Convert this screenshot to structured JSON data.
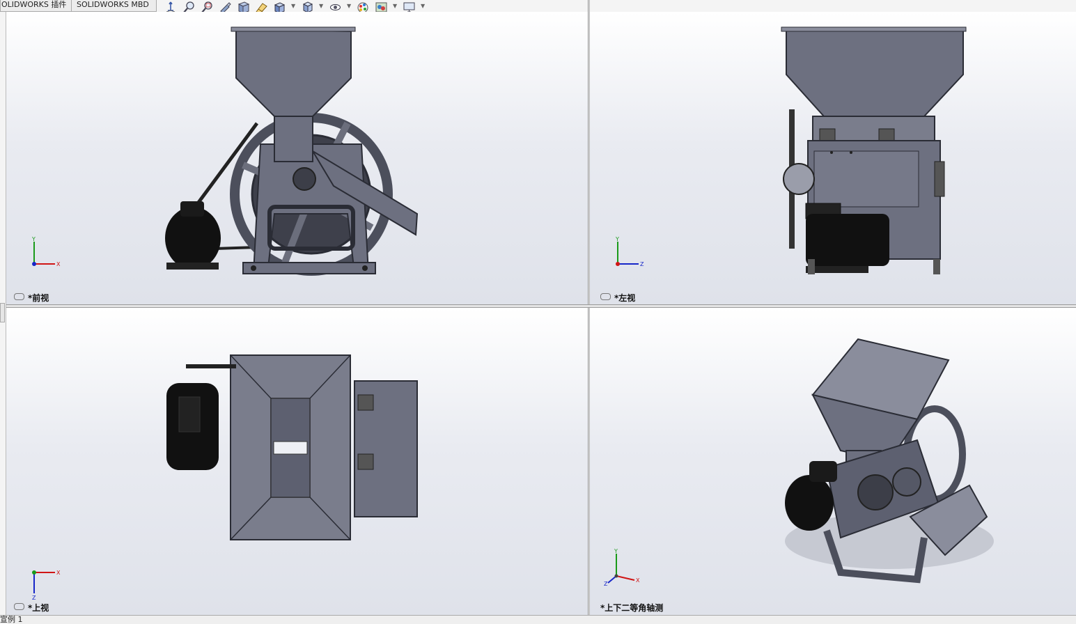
{
  "tabs": {
    "plugins": "OLIDWORKS 插件",
    "mbd": "SOLIDWORKS MBD"
  },
  "heads_up_toolbar": [
    {
      "icon": "view-orientation-icon"
    },
    {
      "icon": "zoom-to-fit-icon"
    },
    {
      "icon": "zoom-to-area-icon"
    },
    {
      "icon": "previous-view-icon"
    },
    {
      "icon": "section-view-icon"
    },
    {
      "icon": "dynamic-annotation-icon"
    },
    {
      "icon": "view-orientation-cube-icon"
    },
    {
      "icon": "display-style-icon"
    },
    {
      "icon": "hide-show-items-icon"
    },
    {
      "icon": "edit-appearance-icon"
    },
    {
      "icon": "apply-scene-icon"
    },
    {
      "icon": "view-settings-icon"
    }
  ],
  "viewports": {
    "front": {
      "label": "*前视"
    },
    "left": {
      "label": "*左视"
    },
    "top": {
      "label": "*上视"
    },
    "dimetric": {
      "label": "*上下二等角轴测"
    }
  },
  "triads": {
    "front": {
      "a": "Y",
      "b": "X"
    },
    "left": {
      "a": "Y",
      "b": "Z"
    },
    "top": {
      "a": "X",
      "b": "Z"
    },
    "dimetric": {
      "a": "Y",
      "b": "X",
      "c": "Z"
    }
  },
  "statusbar": {
    "text": "宣例 1"
  },
  "colors": {
    "metal": "#6d7080",
    "metal_dark": "#4e5160",
    "motor": "#111111",
    "axis_x": "#d01515",
    "axis_y": "#1a9a1a",
    "axis_z": "#1626c8"
  }
}
